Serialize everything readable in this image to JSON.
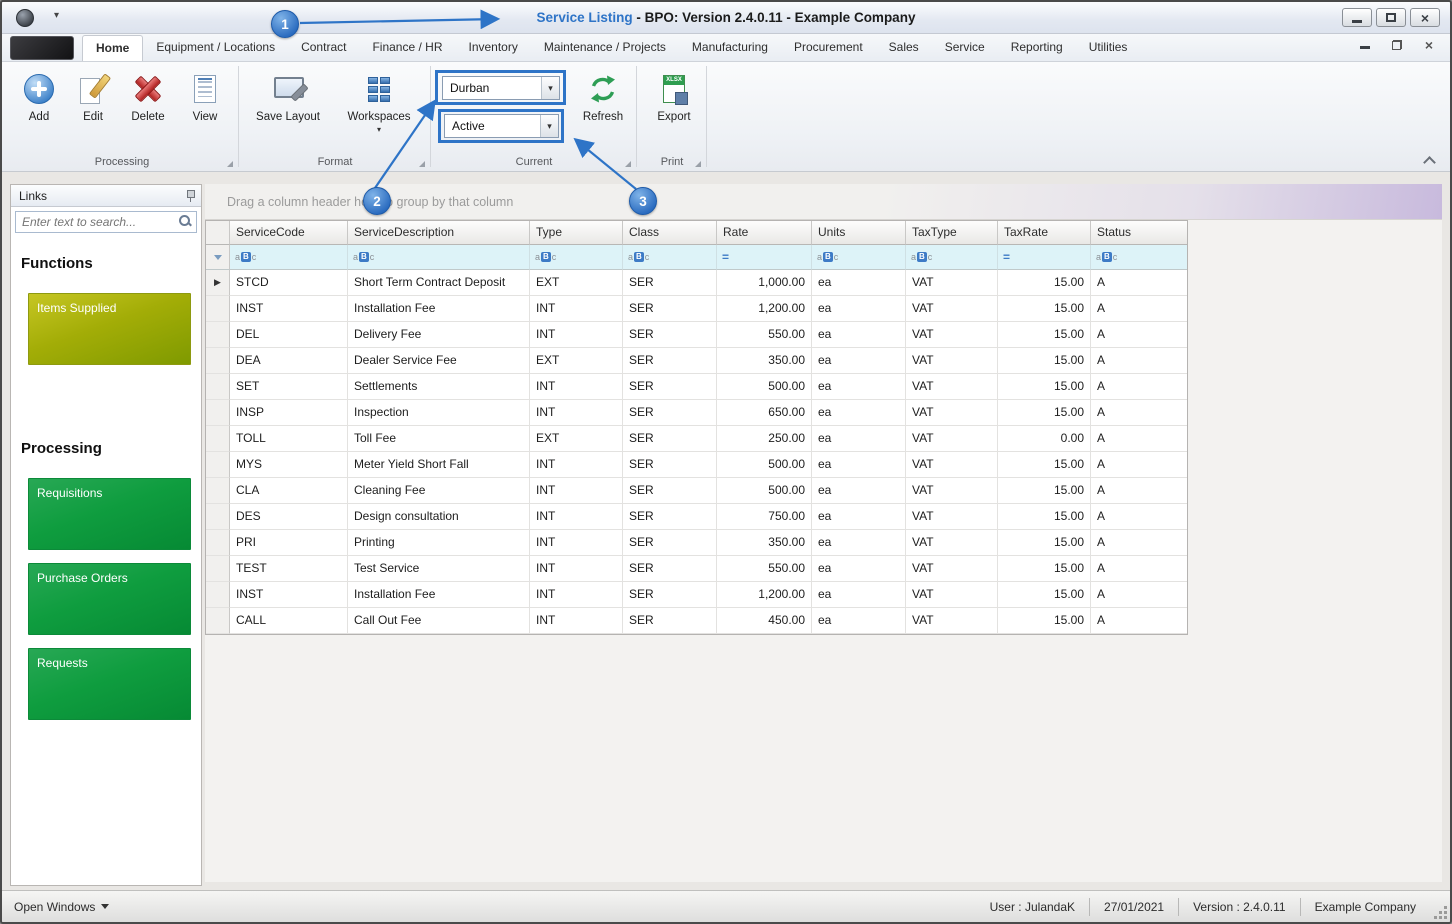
{
  "window": {
    "title_primary": "Service Listing",
    "title_suffix": " - BPO: Version 2.4.0.11 - Example Company"
  },
  "tabs": [
    {
      "label": "Home",
      "cls": "active"
    },
    {
      "label": "Equipment / Locations",
      "cls": ""
    },
    {
      "label": "Contract",
      "cls": ""
    },
    {
      "label": "Finance / HR",
      "cls": ""
    },
    {
      "label": "Inventory",
      "cls": ""
    },
    {
      "label": "Maintenance / Projects",
      "cls": ""
    },
    {
      "label": "Manufacturing",
      "cls": ""
    },
    {
      "label": "Procurement",
      "cls": ""
    },
    {
      "label": "Sales",
      "cls": ""
    },
    {
      "label": "Service",
      "cls": ""
    },
    {
      "label": "Reporting",
      "cls": ""
    },
    {
      "label": "Utilities",
      "cls": ""
    }
  ],
  "ribbon": {
    "buttons": {
      "add": "Add",
      "edit": "Edit",
      "delete": "Delete",
      "view": "View",
      "save_layout": "Save Layout",
      "workspaces": "Workspaces",
      "refresh": "Refresh",
      "export": "Export"
    },
    "combos": {
      "site": "Durban",
      "status": "Active"
    },
    "groups": {
      "processing": "Processing",
      "format": "Format",
      "current": "Current",
      "print": "Print"
    }
  },
  "sidebar": {
    "panel_title": "Links",
    "search_placeholder": "Enter text to search...",
    "functions_heading": "Functions",
    "processing_heading": "Processing",
    "function_items": {
      "items_supplied": "Items Supplied"
    },
    "processing_items": {
      "requisitions": "Requisitions",
      "purchase_orders": "Purchase Orders",
      "requests": "Requests"
    }
  },
  "grid": {
    "group_by_hint": "Drag a column header here to group by that column",
    "columns": [
      {
        "label": "ServiceCode",
        "cls": "c-code"
      },
      {
        "label": "ServiceDescription",
        "cls": "c-desc"
      },
      {
        "label": "Type",
        "cls": "c-type"
      },
      {
        "label": "Class",
        "cls": "c-class"
      },
      {
        "label": "Rate",
        "cls": "c-rate"
      },
      {
        "label": "Units",
        "cls": "c-units"
      },
      {
        "label": "TaxType",
        "cls": "c-taxtype"
      },
      {
        "label": "TaxRate",
        "cls": "c-taxrate"
      },
      {
        "label": "Status",
        "cls": "c-status"
      }
    ],
    "filter_abc": [
      "a",
      "B",
      "c"
    ],
    "filter_eq": "=",
    "rows": [
      {
        "indicator": "▶",
        "code": "STCD",
        "description": "Short Term Contract Deposit",
        "type": "EXT",
        "class": "SER",
        "rate": "1,000.00",
        "units": "ea",
        "taxtype": "VAT",
        "taxrate": "15.00",
        "status": "A"
      },
      {
        "indicator": "",
        "code": "INST",
        "description": "Installation Fee",
        "type": "INT",
        "class": "SER",
        "rate": "1,200.00",
        "units": "ea",
        "taxtype": "VAT",
        "taxrate": "15.00",
        "status": "A"
      },
      {
        "indicator": "",
        "code": "DEL",
        "description": "Delivery Fee",
        "type": "INT",
        "class": "SER",
        "rate": "550.00",
        "units": "ea",
        "taxtype": "VAT",
        "taxrate": "15.00",
        "status": "A"
      },
      {
        "indicator": "",
        "code": "DEA",
        "description": "Dealer Service Fee",
        "type": "EXT",
        "class": "SER",
        "rate": "350.00",
        "units": "ea",
        "taxtype": "VAT",
        "taxrate": "15.00",
        "status": "A"
      },
      {
        "indicator": "",
        "code": "SET",
        "description": "Settlements",
        "type": "INT",
        "class": "SER",
        "rate": "500.00",
        "units": "ea",
        "taxtype": "VAT",
        "taxrate": "15.00",
        "status": "A"
      },
      {
        "indicator": "",
        "code": "INSP",
        "description": "Inspection",
        "type": "INT",
        "class": "SER",
        "rate": "650.00",
        "units": "ea",
        "taxtype": "VAT",
        "taxrate": "15.00",
        "status": "A"
      },
      {
        "indicator": "",
        "code": "TOLL",
        "description": "Toll Fee",
        "type": "EXT",
        "class": "SER",
        "rate": "250.00",
        "units": "ea",
        "taxtype": "VAT",
        "taxrate": "0.00",
        "status": "A"
      },
      {
        "indicator": "",
        "code": "MYS",
        "description": "Meter Yield Short Fall",
        "type": "INT",
        "class": "SER",
        "rate": "500.00",
        "units": "ea",
        "taxtype": "VAT",
        "taxrate": "15.00",
        "status": "A"
      },
      {
        "indicator": "",
        "code": "CLA",
        "description": "Cleaning Fee",
        "type": "INT",
        "class": "SER",
        "rate": "500.00",
        "units": "ea",
        "taxtype": "VAT",
        "taxrate": "15.00",
        "status": "A"
      },
      {
        "indicator": "",
        "code": "DES",
        "description": "Design consultation",
        "type": "INT",
        "class": "SER",
        "rate": "750.00",
        "units": "ea",
        "taxtype": "VAT",
        "taxrate": "15.00",
        "status": "A"
      },
      {
        "indicator": "",
        "code": "PRI",
        "description": "Printing",
        "type": "INT",
        "class": "SER",
        "rate": "350.00",
        "units": "ea",
        "taxtype": "VAT",
        "taxrate": "15.00",
        "status": "A"
      },
      {
        "indicator": "",
        "code": "TEST",
        "description": "Test Service",
        "type": "INT",
        "class": "SER",
        "rate": "550.00",
        "units": "ea",
        "taxtype": "VAT",
        "taxrate": "15.00",
        "status": "A"
      },
      {
        "indicator": "",
        "code": "INST",
        "description": "Installation Fee",
        "type": "INT",
        "class": "SER",
        "rate": "1,200.00",
        "units": "ea",
        "taxtype": "VAT",
        "taxrate": "15.00",
        "status": "A"
      },
      {
        "indicator": "",
        "code": "CALL",
        "description": "Call Out Fee",
        "type": "INT",
        "class": "SER",
        "rate": "450.00",
        "units": "ea",
        "taxtype": "VAT",
        "taxrate": "15.00",
        "status": "A"
      }
    ]
  },
  "statusbar": {
    "open_windows": "Open Windows",
    "user": "User : JulandaK",
    "date": "27/01/2021",
    "version": "Version : 2.4.0.11",
    "company": "Example Company"
  },
  "callouts": {
    "one": "1",
    "two": "2",
    "three": "3"
  },
  "icons": {
    "caret_down": "▾",
    "close": "×",
    "xlsx_label": "XLSX"
  },
  "colors": {
    "accent": "#2e74c7",
    "button_green": "#0f9d3f",
    "button_olive": "#a9b400",
    "filter_row": "#ddf3f8"
  }
}
